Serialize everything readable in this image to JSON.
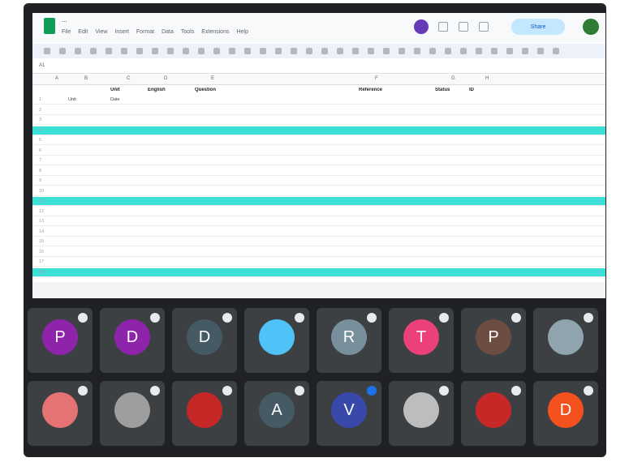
{
  "sheet": {
    "title": "...",
    "share_label": "Share",
    "name_box": "A1",
    "columns": [
      "A",
      "B",
      "C",
      "D",
      "E",
      "F",
      "G",
      "H"
    ],
    "header": [
      "",
      "Unit",
      "English",
      "Question",
      "Reference",
      "Status",
      "ID"
    ],
    "rows": [
      {
        "n": "1",
        "cells": [
          "Unit",
          "Date",
          "",
          "",
          "",
          ""
        ],
        "hl": false
      },
      {
        "n": "2",
        "cells": [
          "",
          "",
          "",
          "",
          "",
          ""
        ],
        "hl": false
      },
      {
        "n": "3",
        "cells": [
          "",
          "",
          "",
          "",
          "",
          ""
        ],
        "hl": false
      },
      {
        "n": "4",
        "cells": [
          "",
          "",
          "",
          "",
          "",
          ""
        ],
        "hl": true
      },
      {
        "n": "5",
        "cells": [
          "",
          "",
          "",
          "",
          "",
          ""
        ],
        "hl": false
      },
      {
        "n": "6",
        "cells": [
          "",
          "",
          "",
          "",
          "",
          ""
        ],
        "hl": false
      },
      {
        "n": "7",
        "cells": [
          "",
          "",
          "",
          "",
          "",
          ""
        ],
        "hl": false
      },
      {
        "n": "8",
        "cells": [
          "",
          "",
          "",
          "",
          "",
          ""
        ],
        "hl": false
      },
      {
        "n": "9",
        "cells": [
          "",
          "",
          "",
          "",
          "",
          ""
        ],
        "hl": false
      },
      {
        "n": "10",
        "cells": [
          "",
          "",
          "",
          "",
          "",
          ""
        ],
        "hl": false
      },
      {
        "n": "11",
        "cells": [
          "",
          "",
          "",
          "",
          "",
          ""
        ],
        "hl": true
      },
      {
        "n": "12",
        "cells": [
          "",
          "",
          "",
          "",
          "",
          ""
        ],
        "hl": false
      },
      {
        "n": "13",
        "cells": [
          "",
          "",
          "",
          "",
          "",
          ""
        ],
        "hl": false
      },
      {
        "n": "14",
        "cells": [
          "",
          "",
          "",
          "",
          "",
          ""
        ],
        "hl": false
      },
      {
        "n": "15",
        "cells": [
          "",
          "",
          "",
          "",
          "",
          ""
        ],
        "hl": false
      },
      {
        "n": "16",
        "cells": [
          "",
          "",
          "",
          "",
          "",
          ""
        ],
        "hl": false
      },
      {
        "n": "17",
        "cells": [
          "",
          "",
          "",
          "",
          "",
          ""
        ],
        "hl": false
      },
      {
        "n": "18",
        "cells": [
          "",
          "",
          "",
          "",
          "",
          ""
        ],
        "hl": true
      }
    ],
    "tabs": [
      "",
      "",
      "",
      "",
      "",
      "",
      ""
    ],
    "menu": [
      "File",
      "Edit",
      "View",
      "Insert",
      "Format",
      "Data",
      "Tools",
      "Extensions",
      "Help"
    ]
  },
  "participants": [
    {
      "initial": "P",
      "name": "",
      "color": "#8e24aa"
    },
    {
      "initial": "D",
      "name": "",
      "color": "#8e24aa"
    },
    {
      "initial": "D",
      "name": "",
      "color": "#455a64"
    },
    {
      "initial": "",
      "name": "",
      "color": "#4fc3f7",
      "photo": true
    },
    {
      "initial": "R",
      "name": "",
      "color": "#78909c"
    },
    {
      "initial": "T",
      "name": "",
      "color": "#ec407a"
    },
    {
      "initial": "P",
      "name": "",
      "color": "#6d4c41"
    },
    {
      "initial": "",
      "name": "",
      "color": "#90a4ae",
      "photo": true
    },
    {
      "initial": "",
      "name": "",
      "color": "#e57373",
      "photo": true
    },
    {
      "initial": "",
      "name": "",
      "color": "#9e9e9e",
      "photo": true
    },
    {
      "initial": "",
      "name": "",
      "color": "#c62828",
      "photo": true
    },
    {
      "initial": "A",
      "name": "",
      "color": "#455a64"
    },
    {
      "initial": "V",
      "name": "",
      "color": "#3949ab",
      "blue": true
    },
    {
      "initial": "",
      "name": "",
      "color": "#bdbdbd",
      "photo": true
    },
    {
      "initial": "",
      "name": "",
      "color": "#c62828",
      "photo": true
    },
    {
      "initial": "D",
      "name": "",
      "color": "#f4511e"
    }
  ]
}
